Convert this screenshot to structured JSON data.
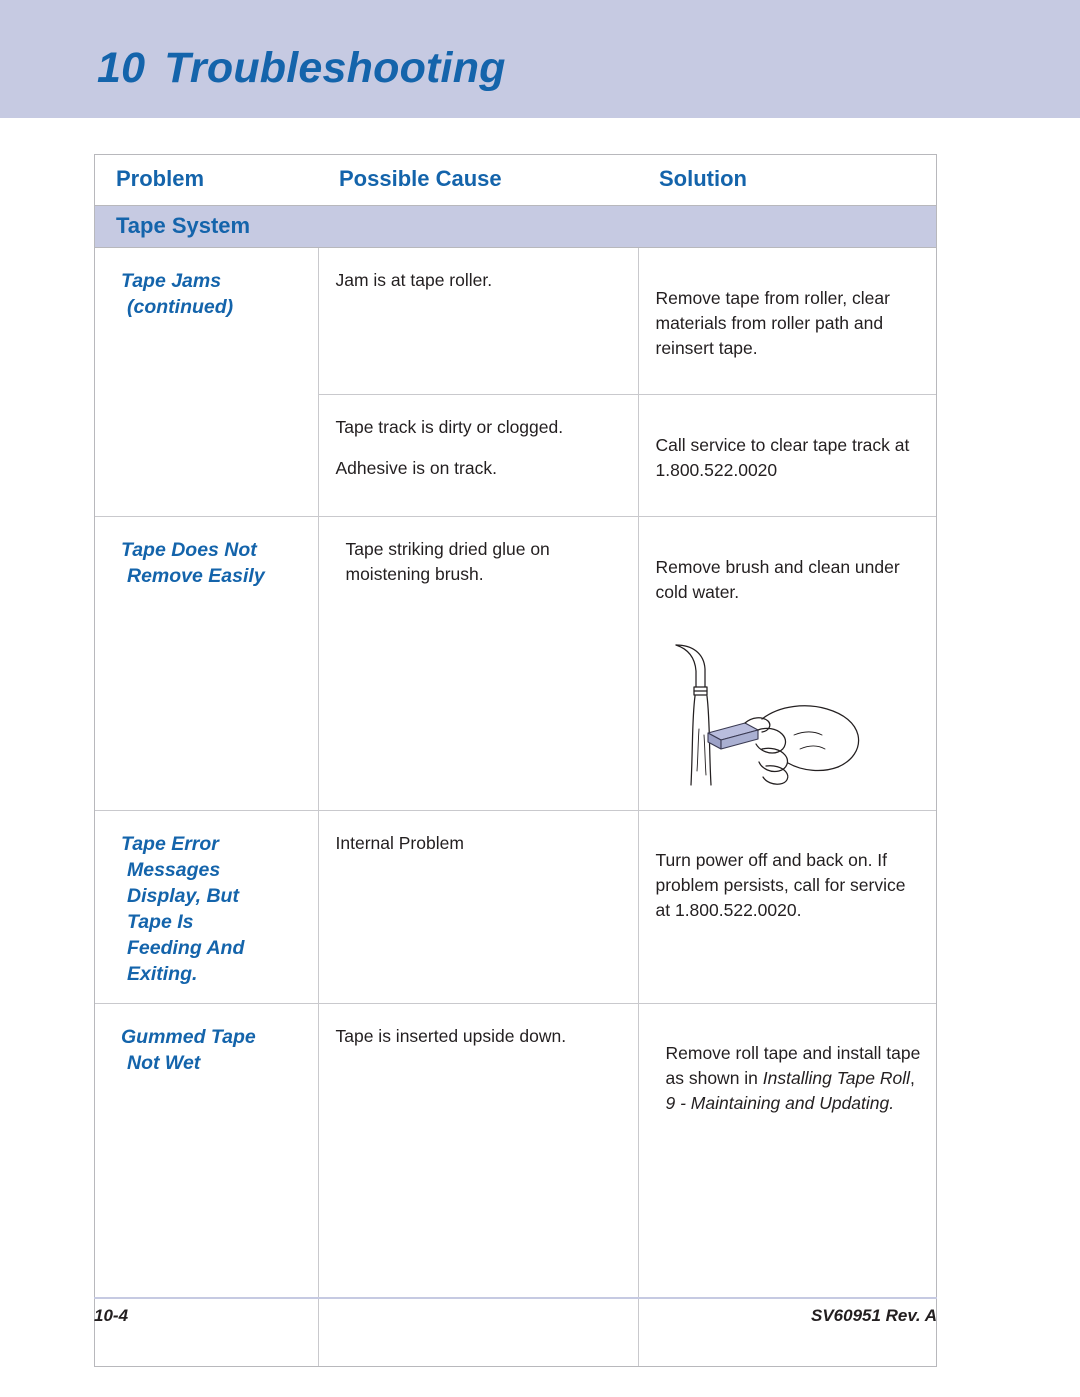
{
  "page": {
    "chapter_number": "10",
    "chapter_title": "Troubleshooting"
  },
  "table": {
    "columns": [
      "Problem",
      "Possible Cause",
      "Solution"
    ],
    "section": "Tape System",
    "rows": [
      {
        "problem_line1": "Tape Jams",
        "problem_line2": "(continued)",
        "cause": "Jam is at tape roller.",
        "solution": "Remove tape from roller, clear materials from roller path and reinsert tape."
      },
      {
        "problem_line1": "",
        "problem_line2": "",
        "cause_line1": "Tape track is dirty or clogged.",
        "cause_line2": "Adhesive is on track.",
        "solution": "Call service to clear tape track at 1.800.522.0020"
      },
      {
        "problem_line1": "Tape Does Not",
        "problem_line2": "Remove Easily",
        "cause": "Tape striking dried glue on moistening brush.",
        "solution": "Remove brush and clean under cold water.",
        "illustration": "faucet-and-hand-with-brush-illustration"
      },
      {
        "problem_line1": "Tape Error",
        "problem_line2": "Messages",
        "problem_line3": "Display, But",
        "problem_line4": "Tape Is",
        "problem_line5": "Feeding And",
        "problem_line6": "Exiting.",
        "cause": "Internal Problem",
        "solution": "Turn power off and back on. If problem persists, call for service at 1.800.522.0020."
      },
      {
        "problem_line1": "Gummed Tape",
        "problem_line2": "Not Wet",
        "cause": "Tape is inserted upside down.",
        "solution_part1": "Remove roll tape and install tape as shown in ",
        "solution_ref1": "Installing Tape Roll",
        "solution_part2": ",",
        "solution_ref2": "9 - Maintaining and Updating."
      }
    ]
  },
  "footer": {
    "page_number": "10-4",
    "document_id": "SV60951 Rev. A"
  },
  "colors": {
    "band": "#c6cae2",
    "accent_blue": "#1464ab",
    "body_text": "#231f20",
    "border": "#c9c9cd"
  }
}
